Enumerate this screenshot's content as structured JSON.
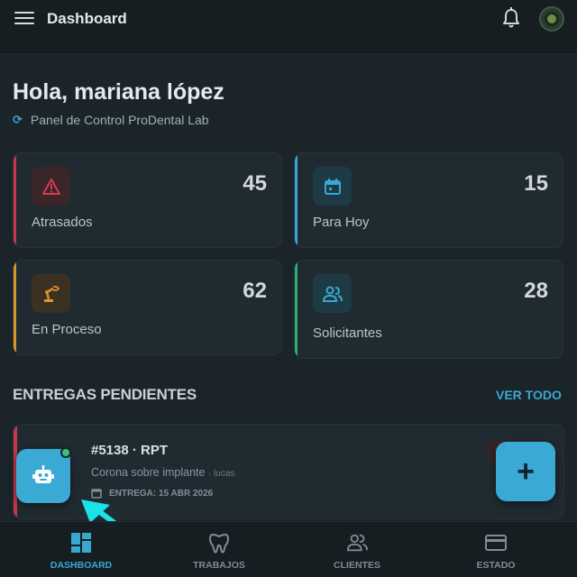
{
  "header": {
    "title": "Dashboard"
  },
  "greeting": "Hola, mariana lópez",
  "subtitle": "Panel de Control ProDental Lab",
  "stats": [
    {
      "label": "Atrasados",
      "value": "45",
      "icon": "warning-icon",
      "color": "#d43c4c"
    },
    {
      "label": "Para Hoy",
      "value": "15",
      "icon": "calendar-icon",
      "color": "#3aa7d2"
    },
    {
      "label": "En Proceso",
      "value": "62",
      "icon": "robot-arm-icon",
      "color": "#d9952a"
    },
    {
      "label": "Solicitantes",
      "value": "28",
      "icon": "users-icon",
      "color": "#2fae7a"
    }
  ],
  "deliveries": {
    "section_title": "ENTREGAS PENDIENTES",
    "see_all": "VER TODO",
    "items": [
      {
        "order": "#5138 · RPT",
        "description": "Corona sobre implante",
        "requester": "· lucas",
        "date": "ENTREGA: 15 ABR 2026"
      }
    ]
  },
  "fab_label": "+",
  "nav": [
    {
      "label": "DASHBOARD",
      "icon": "dashboard-icon",
      "active": true
    },
    {
      "label": "TRABAJOS",
      "icon": "tooth-icon",
      "active": false
    },
    {
      "label": "CLIENTES",
      "icon": "clients-icon",
      "active": false
    },
    {
      "label": "ESTADO",
      "icon": "card-icon",
      "active": false
    }
  ],
  "colors": {
    "accent": "#3aa7d2",
    "background": "#1b2429",
    "card": "#202b31"
  }
}
